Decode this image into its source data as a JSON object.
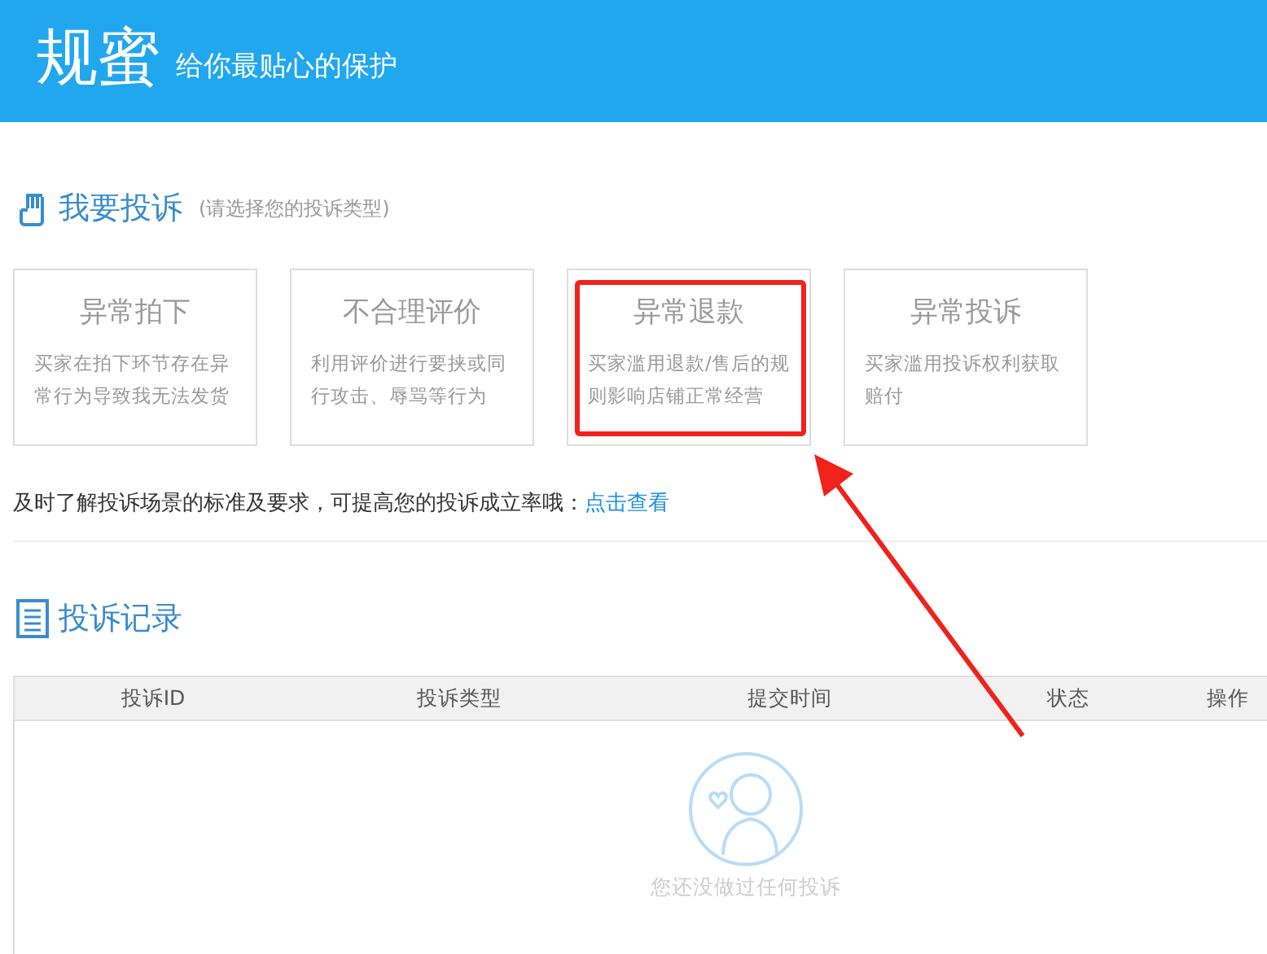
{
  "header": {
    "logo": "规蜜",
    "slogan": "给你最贴心的保护"
  },
  "complaint_section": {
    "title": "我要投诉",
    "hint": "(请选择您的投诉类型)",
    "cards": [
      {
        "title": "异常拍下",
        "description": "买家在拍下环节存在异常行为导致我无法发货",
        "highlighted": false
      },
      {
        "title": "不合理评价",
        "description": "利用评价进行要挟或同行攻击、辱骂等行为",
        "highlighted": false
      },
      {
        "title": "异常退款",
        "description": "买家滥用退款/售后的规则影响店铺正常经营",
        "highlighted": true
      },
      {
        "title": "异常投诉",
        "description": "买家滥用投诉权利获取赔付",
        "highlighted": false
      }
    ],
    "note": "及时了解投诉场景的标准及要求，可提高您的投诉成立率哦：",
    "note_link": "点击查看"
  },
  "records_section": {
    "title": "投诉记录",
    "table": {
      "columns": [
        "投诉ID",
        "投诉类型",
        "提交时间",
        "状态",
        "操作"
      ],
      "empty_message": "您还没做过任何投诉"
    }
  }
}
